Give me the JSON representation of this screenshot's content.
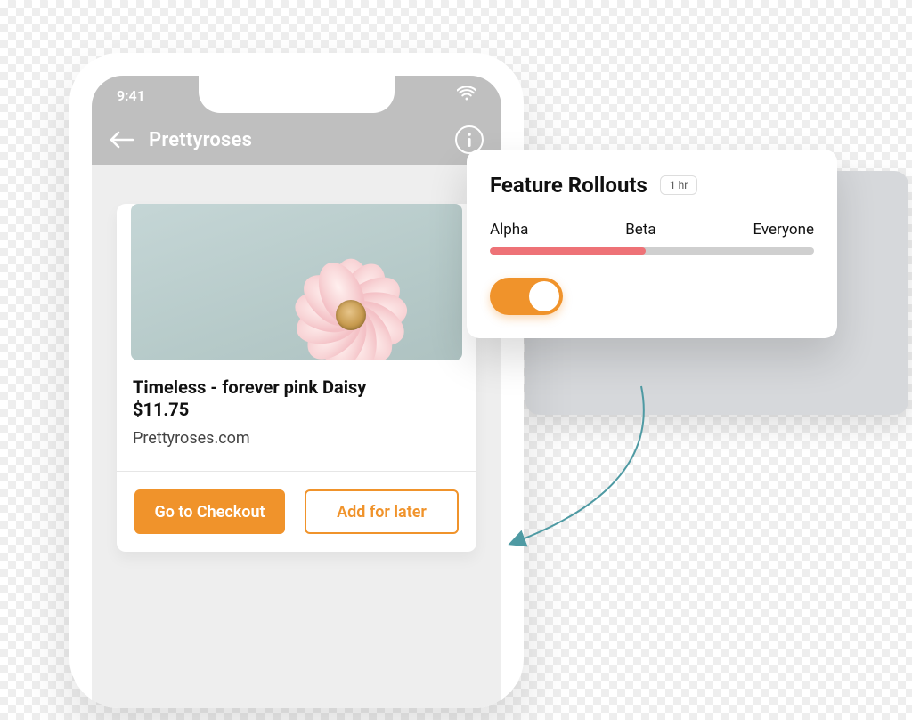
{
  "status": {
    "time": "9:41"
  },
  "nav": {
    "title": "Prettyroses"
  },
  "product": {
    "title": "Timeless - forever pink Daisy",
    "price": "$11.75",
    "site": "Prettyroses.com"
  },
  "actions": {
    "checkout_label": "Go to Checkout",
    "save_label": "Add for later"
  },
  "rollouts": {
    "title": "Feature Rollouts",
    "window": "1 hr",
    "stages": {
      "alpha": "Alpha",
      "beta": "Beta",
      "everyone": "Everyone"
    },
    "progress_percent": 48,
    "toggle_on": true
  },
  "colors": {
    "accent": "#F0932B",
    "meter": "#EE7277"
  }
}
